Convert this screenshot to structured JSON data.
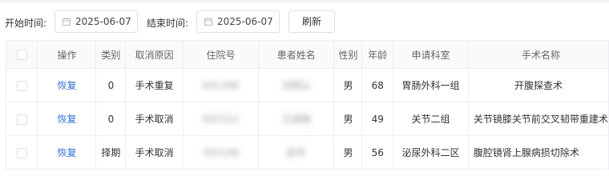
{
  "filters": {
    "start_label": "开始时间:",
    "start_value": "2025-06-07",
    "end_label": "结束时间:",
    "end_value": "2025-06-07",
    "refresh_label": "刷新",
    "icon": "calendar-icon"
  },
  "table": {
    "headers": [
      "操作",
      "类别",
      "取消原因",
      "住院号",
      "患者姓名",
      "性别",
      "年龄",
      "申请科室",
      "手术名称"
    ],
    "rows": [
      {
        "action": "恢复",
        "category": "0",
        "reason": "手术重复",
        "admission_no": "691398",
        "patient": "刘明山",
        "gender": "男",
        "age": "68",
        "dept": "胃肠外科一组",
        "surgery": "开腹探查术"
      },
      {
        "action": "恢复",
        "category": "0",
        "reason": "手术取消",
        "admission_no": "691512",
        "patient": "王淑梅",
        "gender": "男",
        "age": "49",
        "dept": "关节二组",
        "surgery": "关节镜膝关节前交叉韧带重建术"
      },
      {
        "action": "恢复",
        "category": "择期",
        "reason": "手术取消",
        "admission_no": "355106",
        "patient": "赵华",
        "gender": "男",
        "age": "56",
        "dept": "泌尿外科二区",
        "surgery": "腹腔镜肾上腺病损切除术"
      }
    ]
  }
}
